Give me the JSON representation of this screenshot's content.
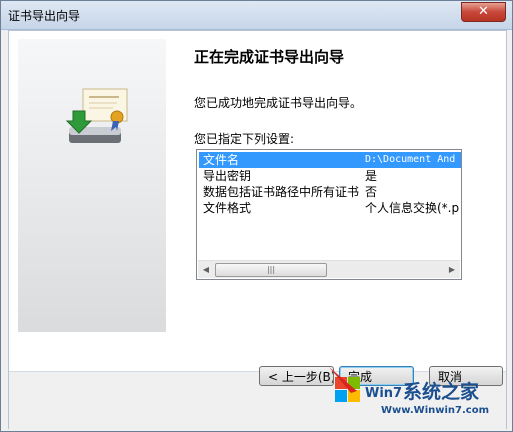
{
  "window": {
    "title": "证书导出向导"
  },
  "heading": "正在完成证书导出向导",
  "message": "您已成功地完成证书导出向导。",
  "list_caption": "您已指定下列设置:",
  "settings": [
    {
      "key": "文件名",
      "value": "D:\\Document And",
      "selected": true
    },
    {
      "key": "导出密钥",
      "value": "是",
      "selected": false
    },
    {
      "key": "数据包括证书路径中所有证书",
      "value": "否",
      "selected": false
    },
    {
      "key": "文件格式",
      "value": "个人信息交换(*.p",
      "selected": false
    }
  ],
  "buttons": {
    "back": "< 上一步(B)",
    "finish": "完成",
    "cancel": "取消"
  },
  "watermark": {
    "brand": "系统之家",
    "url": "Www.Winwin7.com",
    "win_text": "Win7"
  },
  "colors": {
    "selection": "#3399ff",
    "titlebar": "#c6d5e8",
    "close": "#c7483a"
  },
  "icons": {
    "wizard": "certificate-export-icon",
    "close": "close-icon"
  }
}
